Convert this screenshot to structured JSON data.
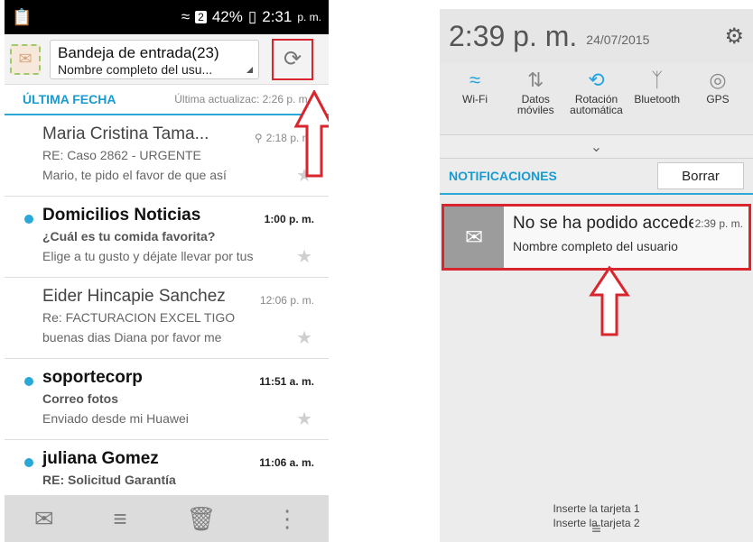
{
  "left": {
    "status": {
      "time": "2:31",
      "ampm": "p. m.",
      "battery": "42%",
      "sim_badge": "2"
    },
    "appbar": {
      "title": "Bandeja de entrada(23)",
      "subtitle": "Nombre completo del usu..."
    },
    "section": {
      "heading": "ÚLTIMA FECHA",
      "updated": "Última actualizac: 2:26 p. m."
    },
    "messages": [
      {
        "sender": "Maria Cristina Tama...",
        "time": "2:18 p. m.",
        "subject": "RE: Caso 2862 - URGENTE",
        "preview": "Mario, te pido el favor de que así",
        "unread": false
      },
      {
        "sender": "Domicilios Noticias",
        "time": "1:00 p. m.",
        "subject": "¿Cuál es tu comida favorita?",
        "preview": "Elige a tu gusto y déjate llevar por tus",
        "unread": true
      },
      {
        "sender": "Eider Hincapie Sanchez",
        "time": "12:06 p. m.",
        "subject": "Re: FACTURACION EXCEL TIGO",
        "preview": "buenas dias Diana por favor me",
        "unread": false
      },
      {
        "sender": "soportecorp",
        "time": "11:51 a. m.",
        "subject": "Correo fotos",
        "preview": "Enviado desde mi Huawei",
        "unread": true
      },
      {
        "sender": "juliana Gomez",
        "time": "11:06 a. m.",
        "subject": "RE: Solicitud Garantía",
        "preview": "",
        "unread": true
      }
    ]
  },
  "right": {
    "time": "2:39 p. m.",
    "date": "24/07/2015",
    "toggles": [
      {
        "label": "Wi-Fi",
        "icon": "wifi-icon",
        "on": true
      },
      {
        "label": "Datos móviles",
        "icon": "data-icon",
        "on": false
      },
      {
        "label": "Rotación automática",
        "icon": "rotate-icon",
        "on": true
      },
      {
        "label": "Bluetooth",
        "icon": "bluetooth-icon",
        "on": false
      },
      {
        "label": "GPS",
        "icon": "gps-icon",
        "on": false
      }
    ],
    "notif_header": "NOTIFICACIONES",
    "clear_label": "Borrar",
    "notification": {
      "title": "No se ha podido acceder",
      "time": "2:39 p. m.",
      "body": "Nombre completo del usuario"
    },
    "sim1": "Inserte la tarjeta 1",
    "sim2": "Inserte la tarjeta 2"
  },
  "colors": {
    "accent": "#2aa8d8",
    "highlight": "#d9262e"
  }
}
